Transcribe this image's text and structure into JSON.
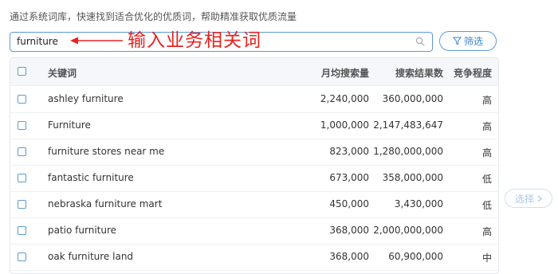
{
  "intro_text": "通过系统词库，快速找到适合优化的优质词，帮助精准获取优质流量",
  "search": {
    "value": "furniture",
    "icon": "search-icon"
  },
  "annotation": {
    "text": "输入业务相关词",
    "color": "#e8231f"
  },
  "filter_button": {
    "label": "筛选",
    "icon": "filter-icon"
  },
  "table": {
    "headers": {
      "keyword": "关键词",
      "monthly_avg": "月均搜索量",
      "results": "搜索结果数",
      "competition": "竞争程度"
    },
    "rows": [
      {
        "keyword": "ashley furniture",
        "monthly_avg": "2,240,000",
        "results": "360,000,000",
        "competition": "高"
      },
      {
        "keyword": "Furniture",
        "monthly_avg": "1,000,000",
        "results": "2,147,483,647",
        "competition": "高"
      },
      {
        "keyword": "furniture stores near me",
        "monthly_avg": "823,000",
        "results": "1,280,000,000",
        "competition": "高"
      },
      {
        "keyword": "fantastic furniture",
        "monthly_avg": "673,000",
        "results": "358,000,000",
        "competition": "低"
      },
      {
        "keyword": "nebraska furniture mart",
        "monthly_avg": "450,000",
        "results": "3,430,000",
        "competition": "低"
      },
      {
        "keyword": "patio furniture",
        "monthly_avg": "368,000",
        "results": "2,000,000,000",
        "competition": "高"
      },
      {
        "keyword": "oak furniture land",
        "monthly_avg": "368,000",
        "results": "60,900,000",
        "competition": "中"
      }
    ]
  },
  "select_button": {
    "label": "选择",
    "icon": "chevron-right-icon"
  },
  "colors": {
    "accent": "#3a86d0",
    "border": "#5b9bd5",
    "annotation": "#e8231f",
    "header_bg": "#f5f7fa"
  }
}
